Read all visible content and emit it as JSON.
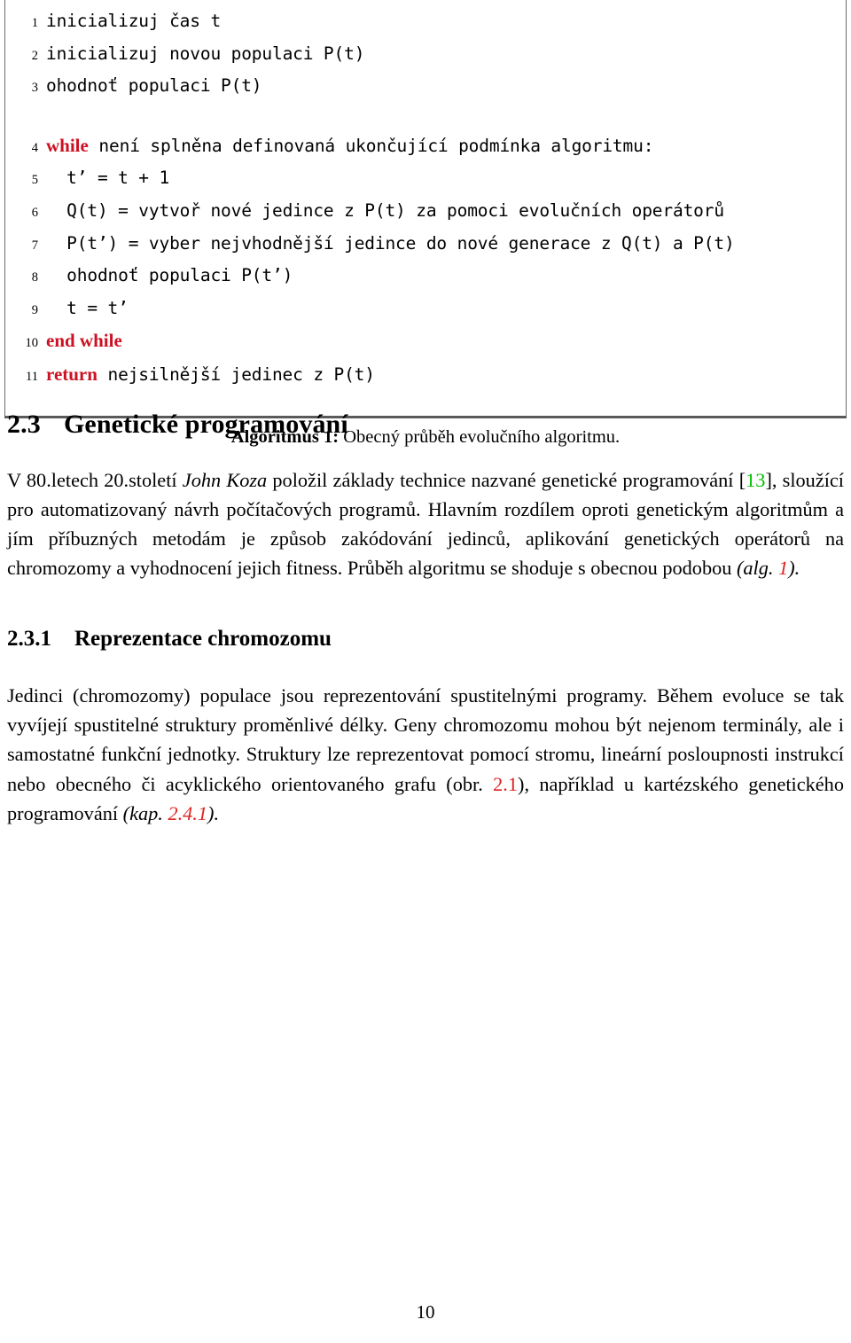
{
  "document": {
    "language": "cs",
    "page_number": "10"
  },
  "algorithm": {
    "caption_label": "Algoritmus 1:",
    "caption_text": "Obecný průběh evolučního algoritmu.",
    "lines": [
      {
        "n": "1",
        "keyword": "",
        "code": "inicializuj čas t"
      },
      {
        "n": "2",
        "keyword": "",
        "code": "inicializuj novou populaci P(t)"
      },
      {
        "n": "3",
        "keyword": "",
        "code": "ohodnoť populaci P(t)"
      },
      {
        "n": "4",
        "keyword": "while",
        "code": " není splněna definovaná ukončující podmínka algoritmu:"
      },
      {
        "n": "5",
        "keyword": "",
        "code": "  t’ = t + 1"
      },
      {
        "n": "6",
        "keyword": "",
        "code": "  Q(t) = vytvoř nové jedince z P(t) za pomoci evolučních operátorů"
      },
      {
        "n": "7",
        "keyword": "",
        "code": "  P(t’) = vyber nejvhodnější jedince do nové generace z Q(t) a P(t)"
      },
      {
        "n": "8",
        "keyword": "",
        "code": "  ohodnoť populaci P(t’)"
      },
      {
        "n": "9",
        "keyword": "",
        "code": "  t = t’"
      },
      {
        "n": "10",
        "keyword": "end while",
        "code": ""
      },
      {
        "n": "11",
        "keyword": "return",
        "code": " nejsilnější jedinec z P(t)"
      }
    ]
  },
  "section": {
    "number": "2.3",
    "title": "Genetické programování",
    "paragraph": {
      "part1": "V 80.letech 20.století ",
      "italic1": "John Koza",
      "part2": " položil základy technice nazvané genetické programování [",
      "cite": "13",
      "part3": "], sloužící pro automatizovaný návrh počítačových programů. Hlavním rozdílem oproti genetickým algoritmům a jím příbuzných metodám je způsob zakódování jedinců, aplikování genetických operátorů na chromozomy a vyhodnocení jejich fitness. Průběh algoritmu se shoduje s obecnou podobou ",
      "ref_open": "(alg. ",
      "ref_num": "1",
      "ref_close": ")."
    }
  },
  "subsection": {
    "number": "2.3.1",
    "title": "Reprezentace chromozomu",
    "paragraph": {
      "part1": "Jedinci (chromozomy) populace jsou reprezentování spustitelnými programy. Během evoluce se tak vyvíjejí spustitelné struktury proměnlivé délky. Geny chromozomu mohou být nejenom terminály, ale i samostatné funkční jednotky. Struktury lze reprezentovat pomocí stromu, lineární posloupnosti instrukcí nebo obecného či acyklického orientovaného grafu ",
      "ref1_open": "(obr. ",
      "ref1_num": "2.1",
      "ref1_close": "), ",
      "part2": "například u kartézského genetického programování ",
      "ref2_open": "(kap. ",
      "ref2_num": "2.4.1",
      "ref2_close": ")."
    }
  },
  "colors": {
    "keyword_red": "#cc1122",
    "citation_green": "#00c000",
    "crossref_red": "#e02020",
    "rule_gray": "#5a5a5a"
  }
}
